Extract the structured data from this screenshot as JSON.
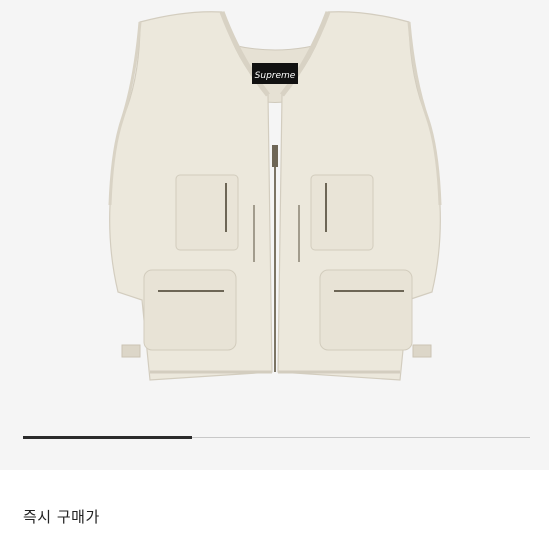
{
  "product": {
    "brand_label": "Supreme",
    "image_icon": "utility-vest-image"
  },
  "carousel": {
    "current_index": 1,
    "total": 3,
    "progress_fraction": 0.333
  },
  "purchase": {
    "instant_buy_label": "즉시 구매가",
    "price": ""
  },
  "colors": {
    "image_background": "#f5f5f5",
    "vest_fabric": "#ede9dd",
    "progress_active": "#2b2b2b",
    "progress_track": "#c8c8c8"
  }
}
